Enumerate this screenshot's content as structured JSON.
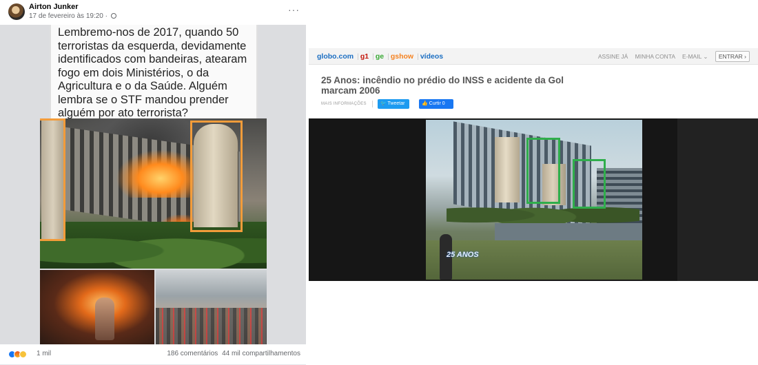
{
  "facebook_post": {
    "author": "Airton Junker",
    "date": "17 de fevereiro às 19:20 ·",
    "more_icon": "more-horizontal-icon",
    "image_text": "Lembremo-nos de 2017, quando 50 terroristas da esquerda, devidamente identificados com bandeiras, atearam fogo em dois  Ministérios, o da Agricultura e o da Saúde. Alguém lembra se o STF mandou prender alguém por ato terrorista?",
    "highlight_color": "#f39c3a",
    "reactions": [
      "like-icon",
      "angry-icon",
      "sad-icon"
    ],
    "reaction_count": "1 mil",
    "comments": "186 comentários",
    "shares": "44 mil compartilhamentos"
  },
  "globo_page": {
    "nav": {
      "globo": "globo.com",
      "g1": "g1",
      "ge": "ge",
      "gshow": "gshow",
      "videos": "vídeos",
      "sep": "|"
    },
    "account": {
      "assine": "ASSINE JÁ",
      "minha_conta": "MINHA CONTA",
      "email": "E-MAIL ⌄",
      "entrar": "ENTRAR ›"
    },
    "title": "25 Anos: incêndio no prédio do INSS e acidente da Gol marcam 2006",
    "more_info": "MAIS INFORMAÇÕES",
    "tweet_button": "Tweetar",
    "like_button": "Curtir 0",
    "video_overlay": "25 ANOS",
    "highlight_color": "#2fae4b"
  }
}
